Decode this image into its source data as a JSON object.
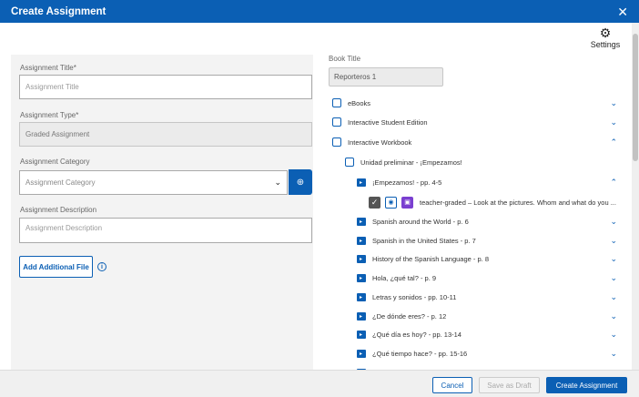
{
  "dialog": {
    "title": "Create Assignment",
    "close_icon": "close-icon"
  },
  "settings": {
    "label": "Settings"
  },
  "form": {
    "title_label": "Assignment Title*",
    "title_placeholder": "Assignment Title",
    "type_label": "Assignment Type*",
    "type_value": "Graded Assignment",
    "category_label": "Assignment Category",
    "category_placeholder": "Assignment Category",
    "description_label": "Assignment Description",
    "description_placeholder": "Assignment Description",
    "add_file_label": "Add Additional File"
  },
  "book": {
    "label": "Book Title",
    "value": "Reporteros 1",
    "tree": [
      {
        "label": "eBooks",
        "state": "collapsed"
      },
      {
        "label": "Interactive Student Edition",
        "state": "collapsed"
      },
      {
        "label": "Interactive Workbook",
        "state": "expanded"
      },
      {
        "label": "Unidad preliminar - ¡Empezamos!",
        "state": "none"
      },
      {
        "label": "¡Empezamos! - pp. 4-5",
        "state": "expanded"
      },
      {
        "label": "teacher-graded – Look at the pictures. Whom and what do you ...",
        "state": "none"
      },
      {
        "label": "Spanish around the World - p. 6",
        "state": "collapsed"
      },
      {
        "label": "Spanish in the United States - p. 7",
        "state": "collapsed"
      },
      {
        "label": "History of the Spanish Language - p. 8",
        "state": "collapsed"
      },
      {
        "label": "Hola, ¿qué tal? - p. 9",
        "state": "collapsed"
      },
      {
        "label": "Letras y sonidos - pp. 10-11",
        "state": "collapsed"
      },
      {
        "label": "¿De dónde eres? - p. 12",
        "state": "collapsed"
      },
      {
        "label": "¿Qué día es hoy? - pp. 13-14",
        "state": "collapsed"
      },
      {
        "label": "¿Qué tiempo hace? - pp. 15-16",
        "state": "collapsed"
      }
    ]
  },
  "footer": {
    "cancel": "Cancel",
    "save_draft": "Save as Draft",
    "create": "Create Assignment"
  },
  "colors": {
    "accent": "#0b5fb4",
    "activity": "#7a3fd0"
  }
}
